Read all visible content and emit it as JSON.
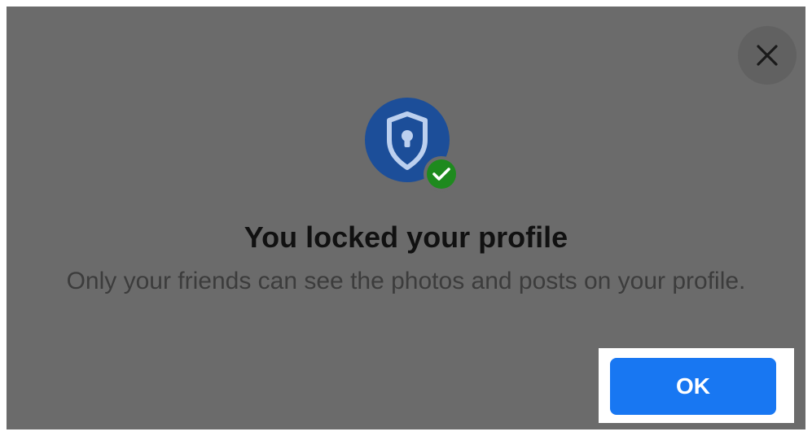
{
  "dialog": {
    "title": "You locked your profile",
    "description": "Only your friends can see the photos and posts on your profile.",
    "ok_label": "OK",
    "close_icon": "close-icon",
    "badge_icon": "shield-lock-icon",
    "check_icon": "check-icon"
  },
  "colors": {
    "overlay": "#6b6b6b",
    "primary_button": "#1877f2",
    "badge_blue": "#1c4e99",
    "check_green": "#1e8a1e"
  }
}
